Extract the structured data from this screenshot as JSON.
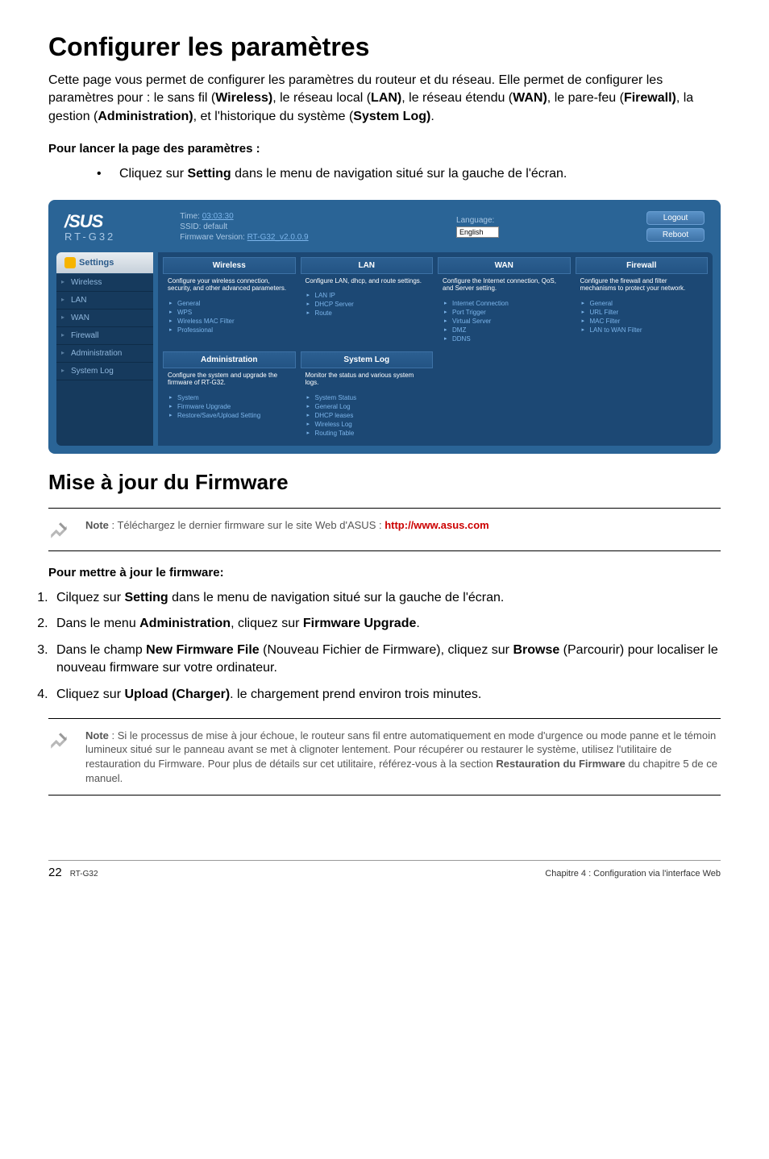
{
  "title": "Configurer les paramètres",
  "intro_parts": {
    "p1": "Cette page vous permet de configurer les paramètres du routeur et du réseau. Elle permet de configurer les paramètres pour : le sans fil (",
    "b1": "Wireless)",
    "p2": ", le réseau local (",
    "b2": "LAN)",
    "p3": ", le réseau étendu (",
    "b3": "WAN)",
    "p4": ", le pare-feu (",
    "b4": "Firewall)",
    "p5": ", la gestion (",
    "b5": "Administration)",
    "p6": ", et l'historique du système (",
    "b6": "System Log)",
    "p7": "."
  },
  "launch_heading": "Pour lancer la page des paramètres :",
  "launch_step_before": "Cliquez sur ",
  "launch_step_bold": "Setting",
  "launch_step_after": " dans le menu de navigation situé sur la gauche de l'écran.",
  "screenshot": {
    "logo": "/SUS",
    "model": "RT-G32",
    "time_label": "Time:",
    "time_value": "03:03:30",
    "ssid_label": "SSID:",
    "ssid_value": "default",
    "fw_label": "Firmware Version:",
    "fw_value": "RT-G32_v2.0.0.9",
    "language": "Language:",
    "lang_value": "English",
    "btn_logout": "Logout",
    "btn_reboot": "Reboot",
    "settings_tab": "Settings",
    "nav": [
      "Wireless",
      "LAN",
      "WAN",
      "Firewall",
      "Administration",
      "System Log"
    ],
    "cards_row1": [
      {
        "title": "Wireless",
        "desc": "Configure your wireless connection, security, and other advanced parameters.",
        "links": [
          "General",
          "WPS",
          "Wireless MAC Filter",
          "Professional"
        ]
      },
      {
        "title": "LAN",
        "desc": "Configure LAN, dhcp, and route settings.",
        "links": [
          "LAN IP",
          "DHCP Server",
          "Route"
        ]
      },
      {
        "title": "WAN",
        "desc": "Configure the Internet connection, QoS, and Server setting.",
        "links": [
          "Internet Connection",
          "Port Trigger",
          "Virtual Server",
          "DMZ",
          "DDNS"
        ]
      },
      {
        "title": "Firewall",
        "desc": "Configure the firewall and filter mechanisms to protect your network.",
        "links": [
          "General",
          "URL Filter",
          "MAC Filter",
          "LAN to WAN Filter"
        ]
      }
    ],
    "cards_row2": [
      {
        "title": "Administration",
        "desc": "Configure the system and upgrade the firmware of RT-G32.",
        "links": [
          "System",
          "Firmware Upgrade",
          "Restore/Save/Upload Setting"
        ]
      },
      {
        "title": "System Log",
        "desc": "Monitor the status and various system logs.",
        "links": [
          "System Status",
          "General Log",
          "DHCP leases",
          "Wireless Log",
          "Routing Table"
        ]
      }
    ]
  },
  "firmware_heading": "Mise à jour du Firmware",
  "note1_before": "Note",
  "note1_text": " : Téléchargez le dernier firmware sur le site Web d'ASUS : ",
  "note1_link": "http://www.asus.com",
  "update_heading": "Pour mettre à jour le firmware:",
  "steps": [
    {
      "before": "Cilquez sur ",
      "bold": "Setting",
      "after": " dans le menu de navigation situé sur la gauche de l'écran."
    },
    {
      "before": "Dans le menu ",
      "bold": "Administration",
      "mid": ", cliquez sur ",
      "bold2": "Firmware Upgrade",
      "after": "."
    },
    {
      "before": "Dans le champ ",
      "bold": "New Firmware File",
      "mid": " (Nouveau Fichier de Firmware), cliquez sur ",
      "bold2": "Browse",
      "after": " (Parcourir) pour localiser le nouveau firmware sur votre ordinateur."
    },
    {
      "before": "Cliquez sur ",
      "bold": "Upload (Charger)",
      "after": ". le chargement prend environ trois minutes."
    }
  ],
  "note2_before": "Note",
  "note2_text": " : Si le processus de mise à jour échoue, le routeur sans fil entre automatiquement en mode d'urgence ou mode panne et le témoin lumineux situé sur le panneau avant se met à clignoter lentement. Pour récupérer ou restaurer le système, utilisez l'utilitaire de restauration du Firmware. Pour plus de détails sur cet utilitaire, référez-vous à la section ",
  "note2_bold": "Restauration du Firmware",
  "note2_after": " du chapitre 5 de ce manuel.",
  "footer_page": "22",
  "footer_model": "RT-G32",
  "footer_chapter": "Chapitre 4 : Configuration via l'interface Web"
}
